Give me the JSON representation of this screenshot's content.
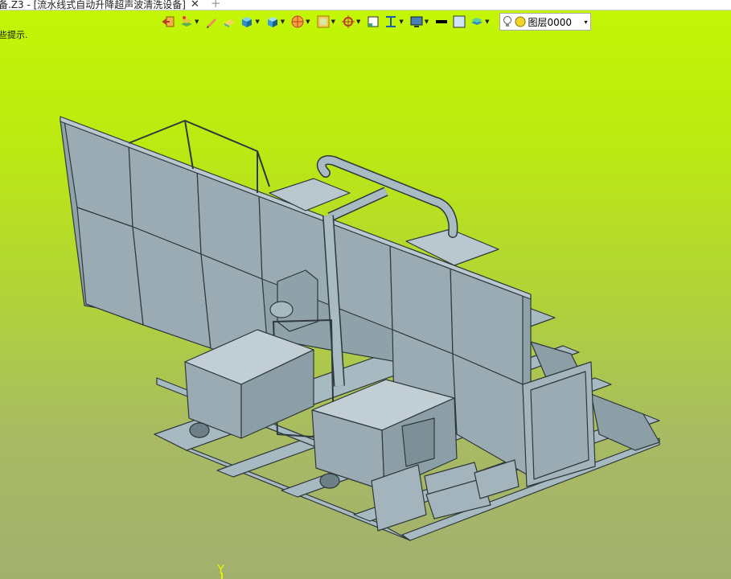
{
  "window": {
    "tab_title": "备.Z3 - [流水线式自动升降超声波清洗设备]",
    "tab_close": "✕",
    "tab_add": "+"
  },
  "toolbar": {
    "buttons": [
      {
        "name": "exit-view-icon",
        "caret": false
      },
      {
        "name": "layer-manager-icon",
        "caret": true
      },
      {
        "name": "pencil-icon",
        "caret": false
      },
      {
        "name": "eraser-icon",
        "caret": false
      },
      {
        "name": "cube-icon",
        "caret": true
      },
      {
        "name": "shaded-display-icon",
        "caret": true
      },
      {
        "name": "render-mode-icon",
        "caret": true
      },
      {
        "name": "texture-icon",
        "caret": true
      },
      {
        "name": "coordinate-icon",
        "caret": true
      },
      {
        "name": "grid-icon",
        "caret": false
      },
      {
        "name": "align-icon",
        "caret": true
      },
      {
        "name": "monitor-view-icon",
        "caret": true
      },
      {
        "name": "line-color-icon",
        "caret": false
      },
      {
        "name": "fill-color-icon",
        "caret": false
      },
      {
        "name": "layer-stack-icon",
        "caret": true
      }
    ],
    "layer_select": {
      "value": "图层0000",
      "dropdown": "▾"
    }
  },
  "hint": "些提示.",
  "axis_label": "Y",
  "colors": {
    "accent_frame": "#3a4246",
    "panel_fill": "#9aabb3",
    "panel_light": "#b9c8cf",
    "bg_top": "#c4f705",
    "bg_bottom": "#a2b06e"
  }
}
